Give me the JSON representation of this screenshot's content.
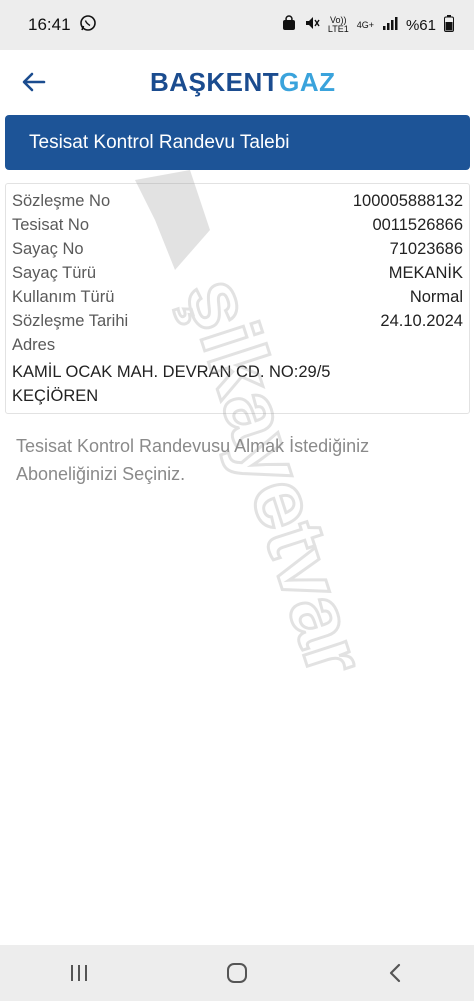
{
  "status_bar": {
    "time": "16:41",
    "volte_label": "Vo))",
    "lte_label": "LTE1",
    "network": "4G+",
    "battery": "%61"
  },
  "header": {
    "logo_part1": "BAŞKENT",
    "logo_part2": "GAZ",
    "back_icon": "arrow-left-icon",
    "brand_colors": {
      "primary": "#1b4c8f",
      "accent": "#3aa3dc"
    }
  },
  "page_title": "Tesisat Kontrol Randevu Talebi",
  "details": {
    "rows": [
      {
        "label": "Sözleşme No",
        "value": "100005888132"
      },
      {
        "label": "Tesisat No",
        "value": "0011526866"
      },
      {
        "label": "Sayaç No",
        "value": "71023686"
      },
      {
        "label": "Sayaç Türü",
        "value": "MEKANİK"
      },
      {
        "label": "Kullanım Türü",
        "value": "Normal"
      },
      {
        "label": "Sözleşme Tarihi",
        "value": "24.10.2024"
      }
    ],
    "address_label": "Adres",
    "address_value": "KAMİL OCAK MAH. DEVRAN CD. NO:29/5 KEÇİÖREN"
  },
  "info_text": "Tesisat Kontrol Randevusu Almak İstediğiniz Aboneliğinizi Seçiniz.",
  "watermark_text": "şikayetvar",
  "nav_bar": {
    "icons": [
      "recent-apps-icon",
      "home-icon",
      "back-icon"
    ]
  }
}
